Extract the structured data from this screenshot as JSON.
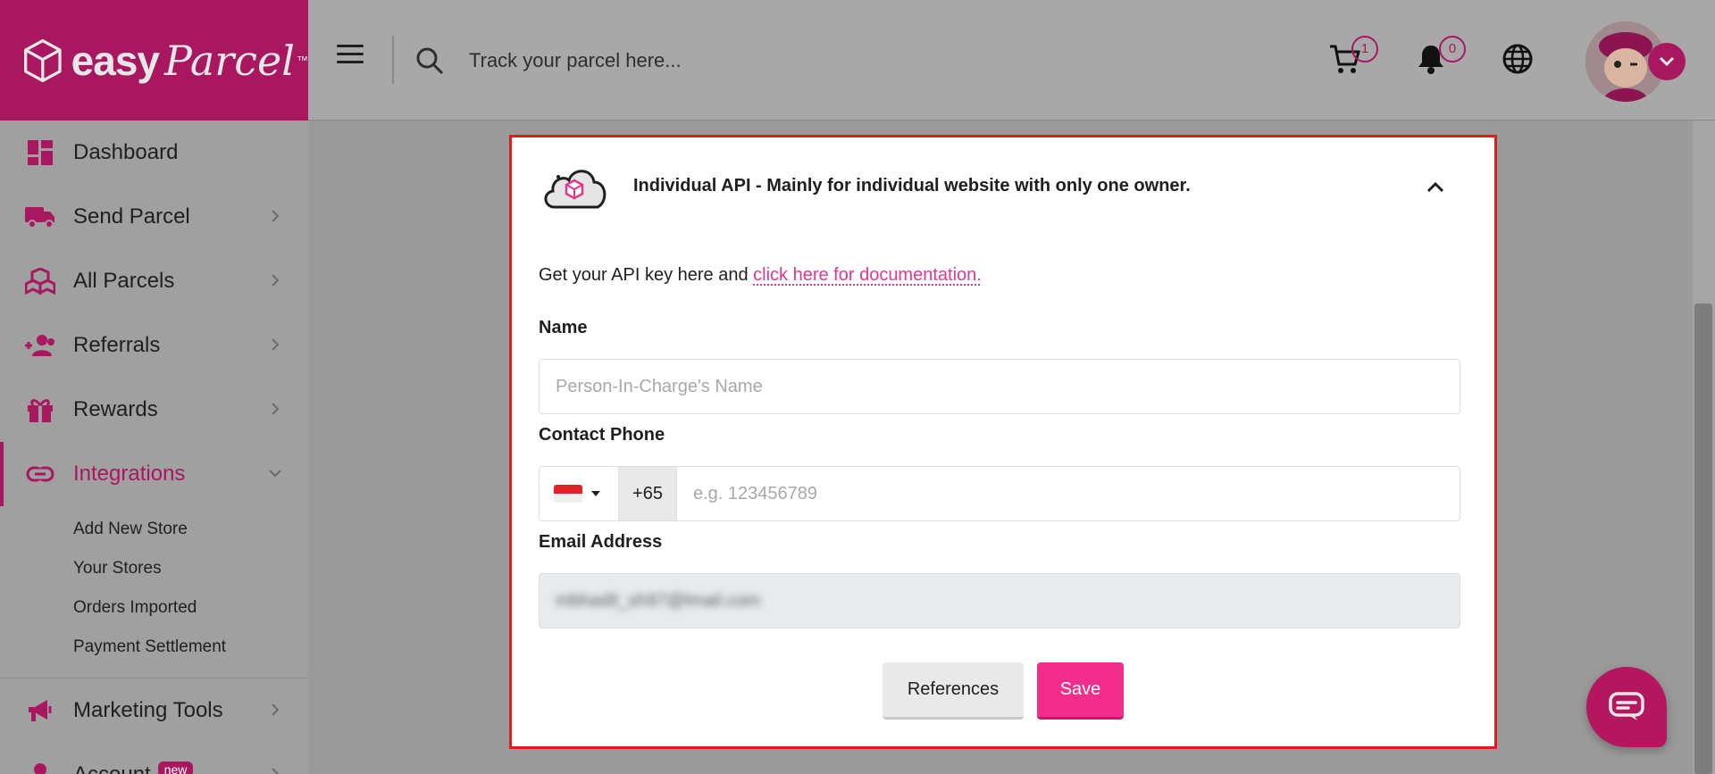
{
  "brand": {
    "name_bold": "easy",
    "name_script": "Parcel",
    "trademark": "™",
    "color": "#a8175f"
  },
  "sidebar": {
    "items": [
      {
        "label": "Dashboard",
        "icon": "dashboard-icon"
      },
      {
        "label": "Send Parcel",
        "icon": "truck-icon"
      },
      {
        "label": "All Parcels",
        "icon": "boxes-icon"
      },
      {
        "label": "Referrals",
        "icon": "user-plus-icon"
      },
      {
        "label": "Rewards",
        "icon": "gift-icon"
      },
      {
        "label": "Integrations",
        "icon": "link-icon",
        "active": true
      },
      {
        "label": "Marketing Tools",
        "icon": "megaphone-icon"
      },
      {
        "label": "Account",
        "icon": "user-icon",
        "badge": "new"
      }
    ],
    "integrations_sub": [
      "Add New Store",
      "Your Stores",
      "Orders Imported",
      "Payment Settlement"
    ]
  },
  "topbar": {
    "search_placeholder": "Track your parcel here...",
    "cart_count": "1",
    "notification_count": "0"
  },
  "modal": {
    "title": "Individual API - Mainly for individual website with only one owner.",
    "intro_text": "Get your API key here and ",
    "intro_link": "click here for documentation.",
    "name_label": "Name",
    "name_placeholder": "Person-In-Charge's Name",
    "phone_label": "Contact Phone",
    "phone_code": "+65",
    "phone_placeholder": "e.g. 123456789",
    "email_label": "Email Address",
    "email_value": "mbhadil_sh97@lmail.com",
    "references_label": "References",
    "save_label": "Save"
  },
  "colors": {
    "accent": "#a8175f",
    "save_button": "#f22d8b",
    "link": "#e4368c",
    "highlight_border": "#e41b1b"
  }
}
